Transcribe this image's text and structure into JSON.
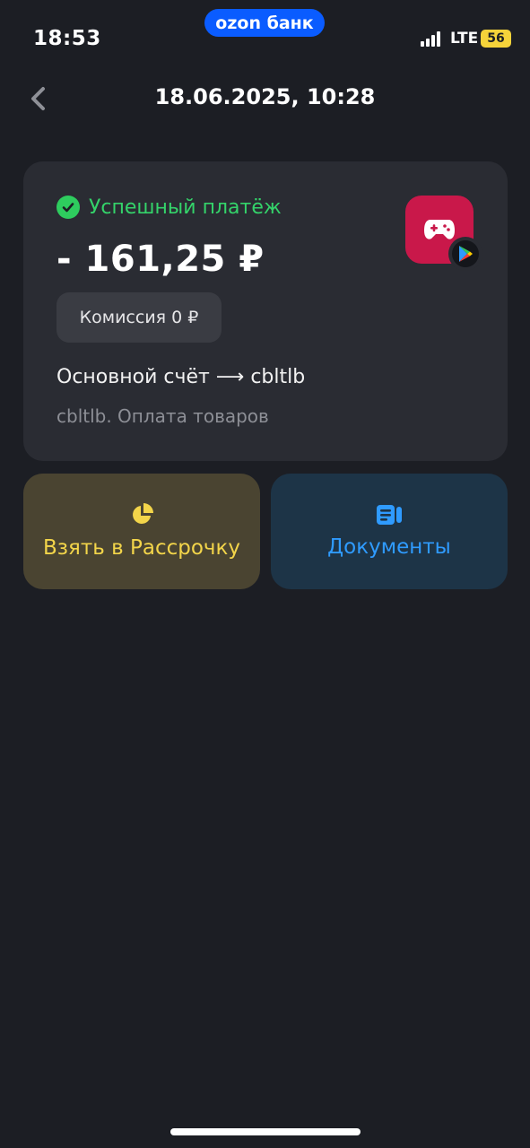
{
  "status_bar": {
    "time": "18:53",
    "brand": "ozon банк",
    "network": "LTE",
    "battery": "56"
  },
  "header": {
    "title": "18.06.2025, 10:28",
    "back_icon": "chevron-left-icon"
  },
  "transaction": {
    "status": "Успешный платёж",
    "amount": "- 161,25 ₽",
    "fee": "Комиссия 0 ₽",
    "route": "Основной счёт ⟶ cbltlb",
    "description": "cbltlb. Оплата товаров",
    "merchant_icon": "gamepad-icon",
    "merchant_badge_icon": "google-play-icon",
    "colors": {
      "status": "#34d36a",
      "merchant_bg": "#c9184a"
    }
  },
  "actions": {
    "installment": {
      "label": "Взять в Рассрочку",
      "icon": "pie-chart-icon",
      "color": "#f3d54a"
    },
    "documents": {
      "label": "Документы",
      "icon": "document-icon",
      "color": "#2f9bff"
    }
  }
}
